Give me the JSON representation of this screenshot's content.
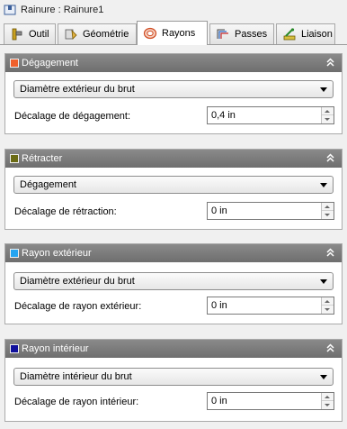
{
  "window": {
    "title": "Rainure : Rainure1",
    "icon": "groove-feature-icon"
  },
  "tabs": [
    {
      "label": "Outil",
      "icon": "tool-icon",
      "active": false
    },
    {
      "label": "Géométrie",
      "icon": "geometry-icon",
      "active": false
    },
    {
      "label": "Rayons",
      "icon": "radii-icon",
      "active": true
    },
    {
      "label": "Passes",
      "icon": "passes-icon",
      "active": false
    },
    {
      "label": "Liaison",
      "icon": "linking-icon",
      "active": false
    }
  ],
  "sections": [
    {
      "title": "Dégagement",
      "color": "#f0602c",
      "dropdown_value": "Diamètre extérieur du brut",
      "field_label": "Décalage de dégagement:",
      "field_value": "0,4 in"
    },
    {
      "title": "Rétracter",
      "color": "#6b6b14",
      "dropdown_value": "Dégagement",
      "field_label": "Décalage de rétraction:",
      "field_value": "0 in"
    },
    {
      "title": "Rayon extérieur",
      "color": "#24a4f0",
      "dropdown_value": "Diamètre extérieur du brut",
      "field_label": "Décalage de rayon extérieur:",
      "field_value": "0 in"
    },
    {
      "title": "Rayon intérieur",
      "color": "#10109c",
      "dropdown_value": "Diamètre intérieur du brut",
      "field_label": "Décalage de rayon intérieur:",
      "field_value": "0 in"
    }
  ]
}
